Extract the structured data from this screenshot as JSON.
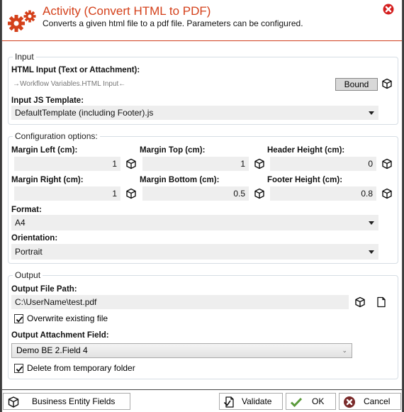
{
  "header": {
    "title": "Activity (Convert HTML to PDF)",
    "subtitle": "Converts a given html file to a pdf file. Parameters can be configured.",
    "icon": "gears-icon",
    "close_icon": "close-icon",
    "accent_color": "#d4401a"
  },
  "input": {
    "legend": "Input",
    "html_input_label": "HTML Input (Text or Attachment):",
    "html_input_binding": "→Workflow Variables.HTML Input←",
    "bound_button": "Bound",
    "js_template_label": "Input JS Template:",
    "js_template_value": "DefaultTemplate (including Footer).js"
  },
  "config": {
    "legend": "Configuration options:",
    "margin_left_label": "Margin Left (cm):",
    "margin_left_value": "1",
    "margin_top_label": "Margin Top (cm):",
    "margin_top_value": "1",
    "header_height_label": "Header Height (cm):",
    "header_height_value": "0",
    "margin_right_label": "Margin Right (cm):",
    "margin_right_value": "1",
    "margin_bottom_label": "Margin Bottom (cm):",
    "margin_bottom_value": "0.5",
    "footer_height_label": "Footer Height (cm):",
    "footer_height_value": "0.8",
    "format_label": "Format:",
    "format_value": "A4",
    "orientation_label": "Orientation:",
    "orientation_value": "Portrait"
  },
  "output": {
    "legend": "Output",
    "file_path_label": "Output File Path:",
    "file_path_value": "C:\\UserName\\test.pdf",
    "overwrite_label": "Overwrite existing file",
    "overwrite_checked": true,
    "attachment_field_label": "Output Attachment Field:",
    "attachment_field_value": "Demo BE 2.Field 4",
    "delete_temp_label": "Delete from temporary folder",
    "delete_temp_checked": true
  },
  "footer": {
    "business_entity_fields": "Business Entity Fields",
    "validate": "Validate",
    "ok": "OK",
    "cancel": "Cancel"
  }
}
